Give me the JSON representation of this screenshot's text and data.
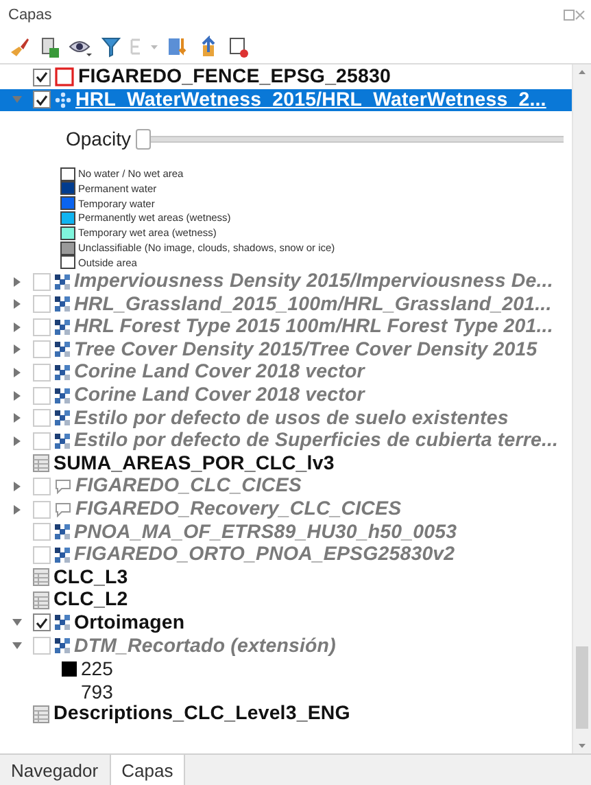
{
  "panel": {
    "title": "Capas"
  },
  "layers": [
    {
      "name": "FIGAREDO_FENCE_EPSG_25830",
      "kind": "polygon",
      "expandable": false,
      "checked": true,
      "visible": true,
      "selected": false
    },
    {
      "name": "HRL_WaterWetness_2015/HRL_WaterWetness_2...",
      "kind": "service",
      "expandable": true,
      "expanded": true,
      "checked": true,
      "visible": true,
      "selected": true,
      "opacity": {
        "label": "Opacity",
        "level": 0
      },
      "legend": [
        {
          "label": "No water / No wet area",
          "color": "#ffffff"
        },
        {
          "label": "Permanent water",
          "color": "#003c8f"
        },
        {
          "label": "Temporary water",
          "color": "#0a64f0"
        },
        {
          "label": "Permanently wet areas (wetness)",
          "color": "#10b4f0"
        },
        {
          "label": "Temporary wet area (wetness)",
          "color": "#7ff5dc"
        },
        {
          "label": "Unclassifiable (No image, clouds, shadows, snow or ice)",
          "color": "#9a9a9a"
        },
        {
          "label": "Outside area",
          "color": "#ffffff"
        }
      ]
    },
    {
      "name": "Imperviousness Density 2015/Imperviousness De...",
      "kind": "raster",
      "expandable": true,
      "expanded": false,
      "checked": false,
      "visible": false,
      "selected": false
    },
    {
      "name": "HRL_Grassland_2015_100m/HRL_Grassland_201...",
      "kind": "raster",
      "expandable": true,
      "expanded": false,
      "checked": false,
      "visible": false,
      "selected": false
    },
    {
      "name": "HRL Forest Type 2015 100m/HRL Forest Type 201...",
      "kind": "raster",
      "expandable": true,
      "expanded": false,
      "checked": false,
      "visible": false,
      "selected": false
    },
    {
      "name": "Tree Cover Density 2015/Tree Cover Density 2015",
      "kind": "raster",
      "expandable": true,
      "expanded": false,
      "checked": false,
      "visible": false,
      "selected": false
    },
    {
      "name": "Corine Land Cover 2018 vector",
      "kind": "raster",
      "expandable": true,
      "expanded": false,
      "checked": false,
      "visible": false,
      "selected": false
    },
    {
      "name": "Corine Land Cover 2018 vector",
      "kind": "raster",
      "expandable": true,
      "expanded": false,
      "checked": false,
      "visible": false,
      "selected": false
    },
    {
      "name": "Estilo por defecto de usos de suelo existentes",
      "kind": "raster",
      "expandable": true,
      "expanded": false,
      "checked": false,
      "visible": false,
      "selected": false
    },
    {
      "name": "Estilo por defecto de Superficies de cubierta terre...",
      "kind": "raster",
      "expandable": true,
      "expanded": false,
      "checked": false,
      "visible": false,
      "selected": false
    },
    {
      "name": "SUMA_AREAS_POR_CLC_lv3",
      "kind": "table",
      "expandable": false,
      "visible": true,
      "selected": false
    },
    {
      "name": "FIGAREDO_CLC_CICES",
      "kind": "tile",
      "expandable": true,
      "expanded": false,
      "checked": false,
      "visible": false,
      "selected": false
    },
    {
      "name": "FIGAREDO_Recovery_CLC_CICES",
      "kind": "tile",
      "expandable": true,
      "expanded": false,
      "checked": false,
      "visible": false,
      "selected": false
    },
    {
      "name": "PNOA_MA_OF_ETRS89_HU30_h50_0053",
      "kind": "raster",
      "expandable": false,
      "checked": false,
      "visible": false,
      "selected": false
    },
    {
      "name": "FIGAREDO_ORTO_PNOA_EPSG25830v2",
      "kind": "raster",
      "expandable": false,
      "checked": false,
      "visible": false,
      "selected": false
    },
    {
      "name": "CLC_L3",
      "kind": "table",
      "expandable": false,
      "visible": true,
      "selected": false
    },
    {
      "name": "CLC_L2",
      "kind": "table",
      "expandable": false,
      "visible": true,
      "selected": false
    },
    {
      "name": "Ortoimagen",
      "kind": "raster",
      "expandable": true,
      "expanded": true,
      "checked": true,
      "visible": true,
      "selected": false
    },
    {
      "name": "DTM_Recortado (extensión)",
      "kind": "raster",
      "expandable": true,
      "expanded": true,
      "checked": false,
      "visible": false,
      "selected": false,
      "values": [
        {
          "label": "225",
          "color": "#000000"
        },
        {
          "label": "793"
        }
      ]
    },
    {
      "name": "Descriptions_CLC_Level3_ENG",
      "kind": "table",
      "expandable": false,
      "visible": true,
      "selected": false
    }
  ],
  "tabs": [
    {
      "label": "Navegador",
      "selected": false
    },
    {
      "label": "Capas",
      "selected": true
    }
  ]
}
